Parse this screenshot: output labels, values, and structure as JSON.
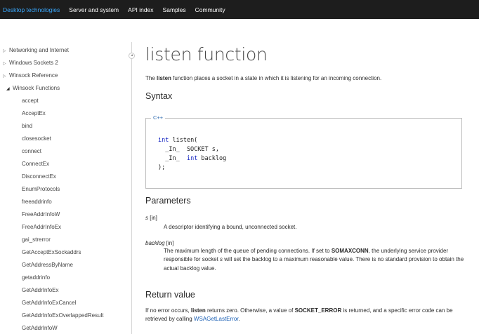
{
  "topnav": {
    "items": [
      "Desktop technologies",
      "Server and system",
      "API index",
      "Samples",
      "Community"
    ]
  },
  "sidebar": {
    "items": [
      {
        "label": "Networking and Internet",
        "arrow": "▷"
      },
      {
        "label": "Windows Sockets 2",
        "arrow": "▷"
      },
      {
        "label": "Winsock Reference",
        "arrow": "▷"
      },
      {
        "label": "Winsock Functions",
        "arrow": "◢"
      },
      {
        "label": "accept"
      },
      {
        "label": "AcceptEx"
      },
      {
        "label": "bind"
      },
      {
        "label": "closesocket"
      },
      {
        "label": "connect"
      },
      {
        "label": "ConnectEx"
      },
      {
        "label": "DisconnectEx"
      },
      {
        "label": "EnumProtocols"
      },
      {
        "label": "freeaddrinfo"
      },
      {
        "label": "FreeAddrInfoW"
      },
      {
        "label": "FreeAddrInfoEx"
      },
      {
        "label": "gai_strerror"
      },
      {
        "label": "GetAcceptExSockaddrs"
      },
      {
        "label": "GetAddressByName"
      },
      {
        "label": "getaddrinfo"
      },
      {
        "label": "GetAddrInfoEx"
      },
      {
        "label": "GetAddrInfoExCancel"
      },
      {
        "label": "GetAddrInfoExOverlappedResult"
      },
      {
        "label": "GetAddrInfoW"
      }
    ]
  },
  "collapse_handle_glyph": "◂",
  "main": {
    "title": "listen function",
    "intro": {
      "prefix": "The ",
      "bold": "listen",
      "suffix": " function places a socket in a state in which it is listening for an incoming connection."
    },
    "syntax_heading": "Syntax",
    "code_lang": "C++",
    "code_lines": [
      {
        "parts": [
          {
            "t": "int",
            "kw": true
          },
          {
            "t": " listen("
          }
        ]
      },
      {
        "parts": [
          {
            "t": "  _In_  SOCKET s,"
          }
        ]
      },
      {
        "parts": [
          {
            "t": "  _In_  "
          },
          {
            "t": "int",
            "kw": true
          },
          {
            "t": " backlog"
          }
        ]
      },
      {
        "parts": [
          {
            "t": ");"
          }
        ]
      }
    ],
    "parameters_heading": "Parameters",
    "params": [
      {
        "name": "s",
        "dir": " [in]",
        "desc_parts": [
          {
            "t": "A descriptor identifying a bound, unconnected socket."
          }
        ]
      },
      {
        "name": "backlog",
        "dir": " [in]",
        "desc_parts": [
          {
            "t": "The maximum length of the queue of pending connections. If set to "
          },
          {
            "t": "SOMAXCONN",
            "b": true
          },
          {
            "t": ", the underlying service provider responsible for socket "
          },
          {
            "t": "s",
            "i": true
          },
          {
            "t": " will set the backlog to a maximum reasonable value. There is no standard provision to obtain the actual backlog value."
          }
        ]
      }
    ],
    "return_heading": "Return value",
    "return_parts": [
      {
        "t": "If no error occurs, "
      },
      {
        "t": "listen",
        "b": true
      },
      {
        "t": " returns zero. Otherwise, a value of "
      },
      {
        "t": "SOCKET_ERROR",
        "b": true
      },
      {
        "t": " is returned, and a specific error code can be retrieved by calling "
      },
      {
        "t": "WSAGetLastError",
        "link": true
      },
      {
        "t": "."
      }
    ]
  },
  "colors": {
    "nav_bg": "#1d1d1d",
    "nav_active": "#3aa9ff",
    "link": "#1a5fb4",
    "keyword": "#1020c0"
  }
}
